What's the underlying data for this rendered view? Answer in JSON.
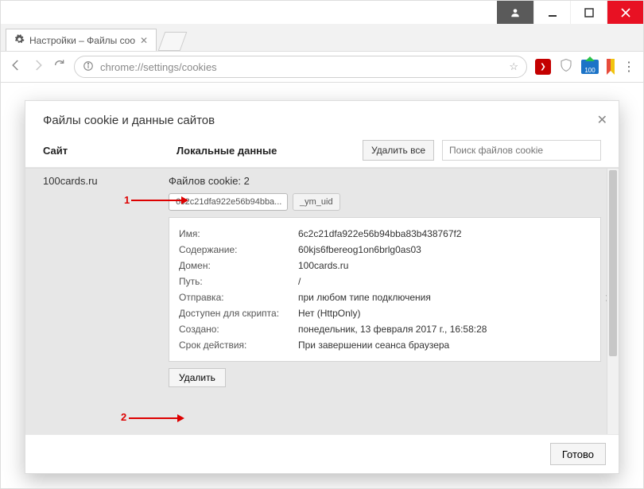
{
  "window": {
    "tab_title": "Настройки – Файлы coo",
    "url": "chrome://settings/cookies"
  },
  "ghost_close": "×",
  "modal": {
    "title": "Файлы cookie и данные сайтов",
    "col_site": "Сайт",
    "col_local": "Локальные данные",
    "delete_all": "Удалить все",
    "search_placeholder": "Поиск файлов cookie",
    "site": "100cards.ru",
    "cookie_count": "Файлов cookie: 2",
    "chips": {
      "active": "6c2c21dfa922e56b94bba...",
      "other": "_ym_uid"
    },
    "details": {
      "name_k": "Имя:",
      "name_v": "6c2c21dfa922e56b94bba83b438767f2",
      "content_k": "Содержание:",
      "content_v": "60kjs6fbereog1on6brlg0as03",
      "domain_k": "Домен:",
      "domain_v": "100cards.ru",
      "path_k": "Путь:",
      "path_v": "/",
      "send_k": "Отправка:",
      "send_v": "при любом типе подключения",
      "script_k": "Доступен для скрипта:",
      "script_v": "Нет (HttpOnly)",
      "created_k": "Создано:",
      "created_v": "понедельник, 13 февраля 2017 г., 16:58:28",
      "expires_k": "Срок действия:",
      "expires_v": "При завершении сеанса браузера"
    },
    "delete_btn": "Удалить",
    "done_btn": "Готово"
  },
  "annotations": {
    "one": "1",
    "two": "2"
  },
  "ext": {
    "sf": "100"
  }
}
